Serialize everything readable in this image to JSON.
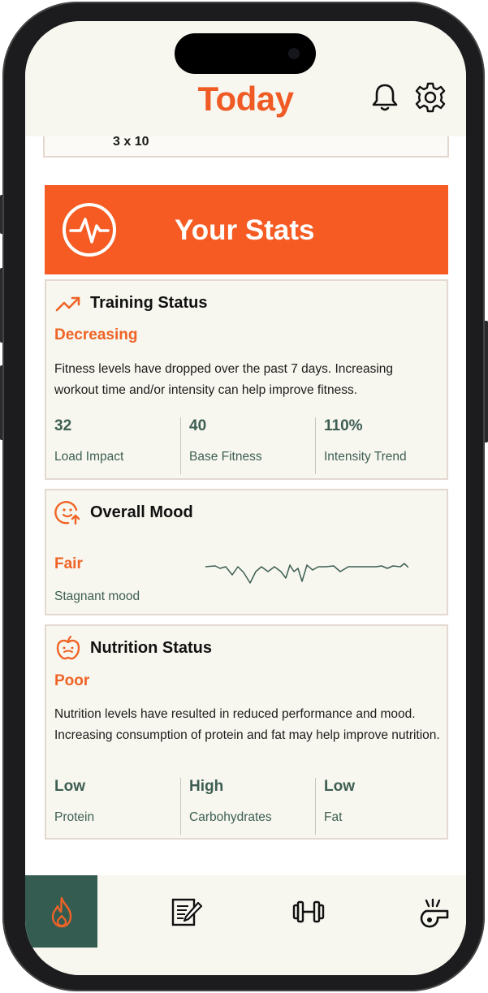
{
  "header": {
    "title": "Today",
    "icons": [
      "bell-icon",
      "gear-icon"
    ]
  },
  "previous_card": {
    "text": "3 x 10"
  },
  "stats_banner": {
    "title": "Your Stats",
    "icon": "pulse-icon"
  },
  "training_status": {
    "title": "Training Status",
    "icon": "trending-up-icon",
    "status": "Decreasing",
    "description": "Fitness levels have dropped over the past 7 days. Increasing workout time and/or intensity can help improve fitness.",
    "metrics": [
      {
        "value": "32",
        "label": "Load Impact"
      },
      {
        "value": "40",
        "label": "Base Fitness"
      },
      {
        "value": "110%",
        "label": "Intensity Trend"
      }
    ]
  },
  "overall_mood": {
    "title": "Overall Mood",
    "icon": "mood-icon",
    "status": "Fair",
    "subtitle": "Stagnant mood"
  },
  "nutrition_status": {
    "title": "Nutrition Status",
    "icon": "apple-icon",
    "status": "Poor",
    "description": "Nutrition levels have resulted in reduced performance and mood. Increasing consumption of protein  and fat may help improve nutrition.",
    "metrics": [
      {
        "value": "Low",
        "label": "Protein"
      },
      {
        "value": "High",
        "label": "Carbohydrates"
      },
      {
        "value": "Low",
        "label": "Fat"
      }
    ]
  },
  "tabbar": {
    "tabs": [
      "flame-icon",
      "journal-icon",
      "dumbbell-icon",
      "whistle-icon"
    ],
    "active_index": 0
  },
  "colors": {
    "accent": "#f55b22",
    "active_tab": "#355c51",
    "metric_text": "#3e5e53",
    "card_bg": "#f7f7ef"
  }
}
